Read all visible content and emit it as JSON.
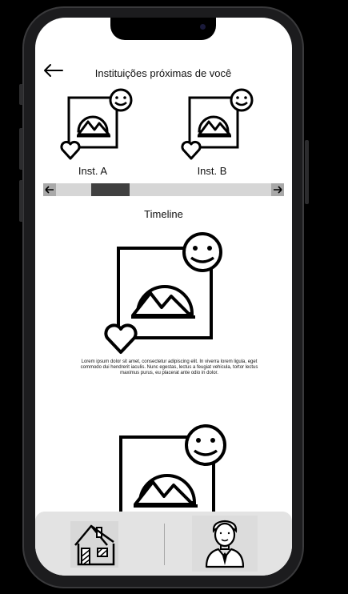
{
  "header": {
    "title": "Instituições próximas de você"
  },
  "institutions": [
    {
      "label": "Inst. A"
    },
    {
      "label": "Inst. B"
    }
  ],
  "scrollbar": {
    "position": 0.2
  },
  "timeline": {
    "title": "Timeline",
    "posts": [
      {
        "text": "Lorem ipsum dolor sit amet, consectetur adipiscing elit. In viverra  lorem ligula, eget commodo dui hendrerit iaculis. Nunc egestas, lectus a feugiat vehicula, tortor lectus maximus purus, eu placerat ante odio in dolor."
      }
    ]
  },
  "icons": {
    "back": "arrow-left-icon",
    "image": "image-placeholder-icon",
    "smiley": "smiley-icon",
    "heart": "heart-icon",
    "home": "home-icon",
    "profile": "profile-icon"
  }
}
